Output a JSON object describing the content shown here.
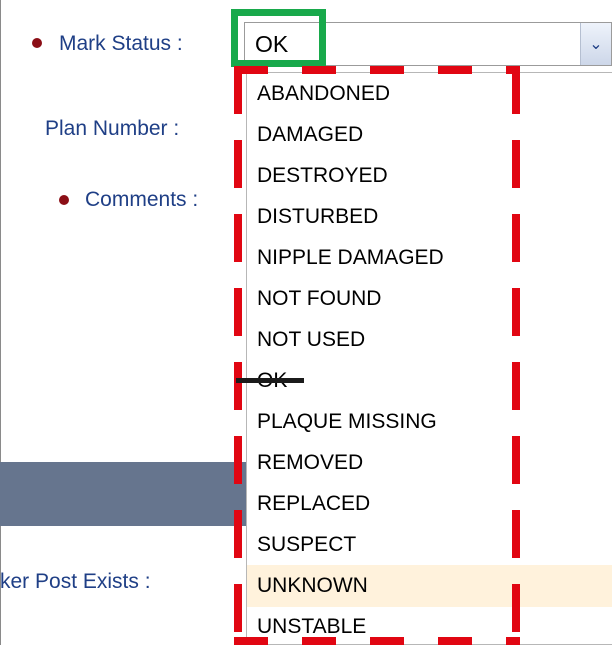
{
  "form": {
    "mark_status_label": "Mark Status :",
    "plan_number_label": "Plan Number :",
    "comments_label": "Comments :",
    "marker_post_exists_label": "ker Post Exists :"
  },
  "dropdown": {
    "selected_value": "OK",
    "options": [
      "ABANDONED",
      "DAMAGED",
      "DESTROYED",
      "DISTURBED",
      "NIPPLE DAMAGED",
      "NOT FOUND",
      "NOT USED",
      "OK",
      "PLAQUE MISSING",
      "REMOVED",
      "REPLACED",
      "SUSPECT",
      "UNKNOWN",
      "UNSTABLE"
    ],
    "highlighted_option": "UNKNOWN"
  },
  "colors": {
    "label_text": "#1f3f86",
    "required_bullet": "#8b0e16",
    "green_annotation": "#18a94b",
    "red_annotation": "#e10612",
    "highlight_row": "#fff2dc",
    "header_band": "#66758e"
  },
  "icons": {
    "select_arrow": "chevron-down-icon",
    "required_marker": "required-bullet-icon"
  }
}
